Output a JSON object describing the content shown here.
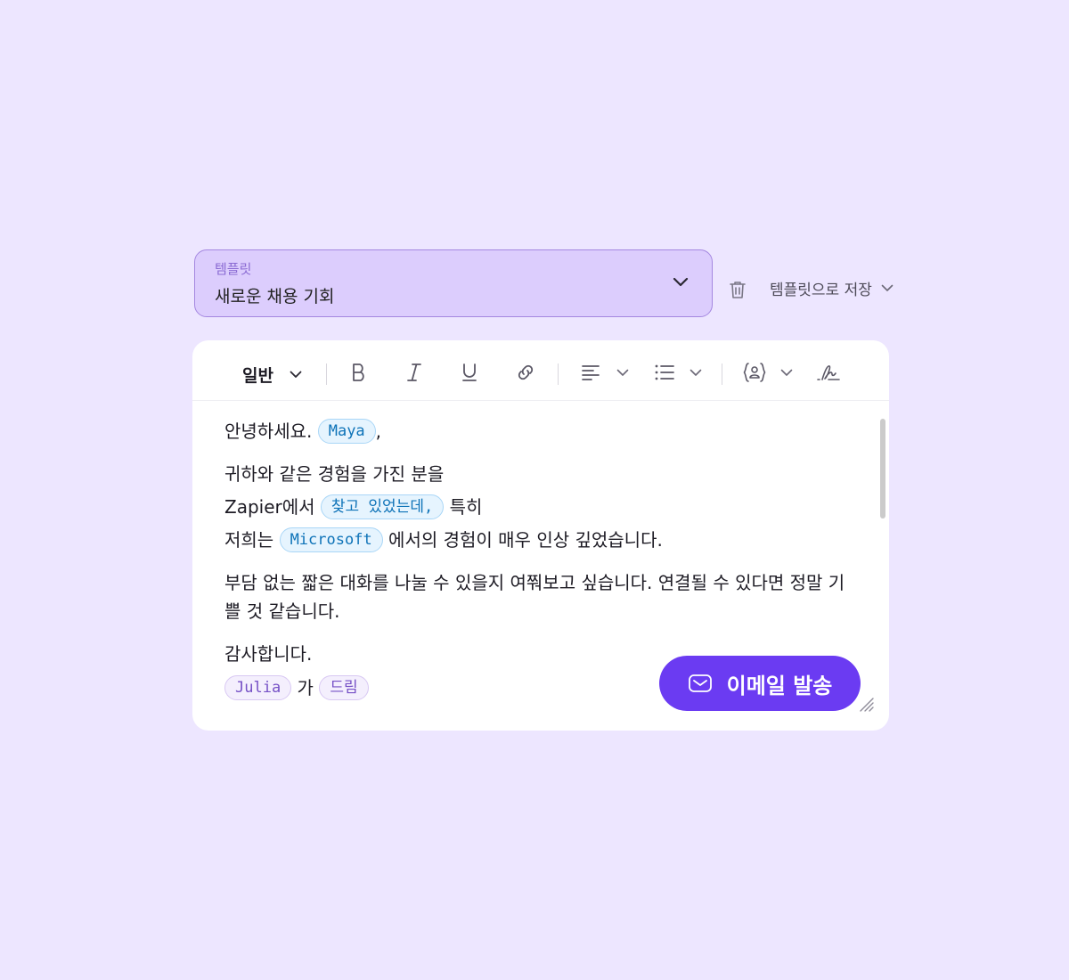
{
  "template": {
    "label": "템플릿",
    "value": "새로운 채용 기회"
  },
  "actions": {
    "save_template": "템플릿으로 저장"
  },
  "toolbar": {
    "text_style": "일반",
    "buttons": [
      "bold-icon",
      "italic-icon",
      "underline-icon",
      "link-icon",
      "align-icon",
      "list-icon",
      "variable-icon",
      "signature-icon"
    ]
  },
  "email": {
    "greeting": "안녕하세요.",
    "recipient": "Maya",
    "greeting_comma": ",",
    "line1": "귀하와 같은 경험을 가진 분을",
    "line2_prefix": "Zapier에서",
    "line2_chip": "찾고 있었는데,",
    "line2_suffix": "특히",
    "line3_prefix": "저희는",
    "line3_chip": "Microsoft",
    "line3_suffix": "에서의 경험이 매우 인상 깊었습니다.",
    "paragraph2_line1": "부담 없는 짧은 대화를 나눌 수 있을지 여쭤보고 싶습니다. 연결될 수 있다면 정말 기",
    "paragraph2_line2": "쁠 것 같습니다.",
    "closing": "감사합니다.",
    "sender": "Julia",
    "sender_particle": "가",
    "sender_suffix": "드림"
  },
  "send_button": {
    "label": "이메일 발송"
  },
  "colors": {
    "background": "#ede6ff",
    "select_bg": "#dccdfd",
    "accent": "#6b3bf2",
    "chip_blue": "#0e73b8",
    "chip_purple": "#7651c6"
  }
}
